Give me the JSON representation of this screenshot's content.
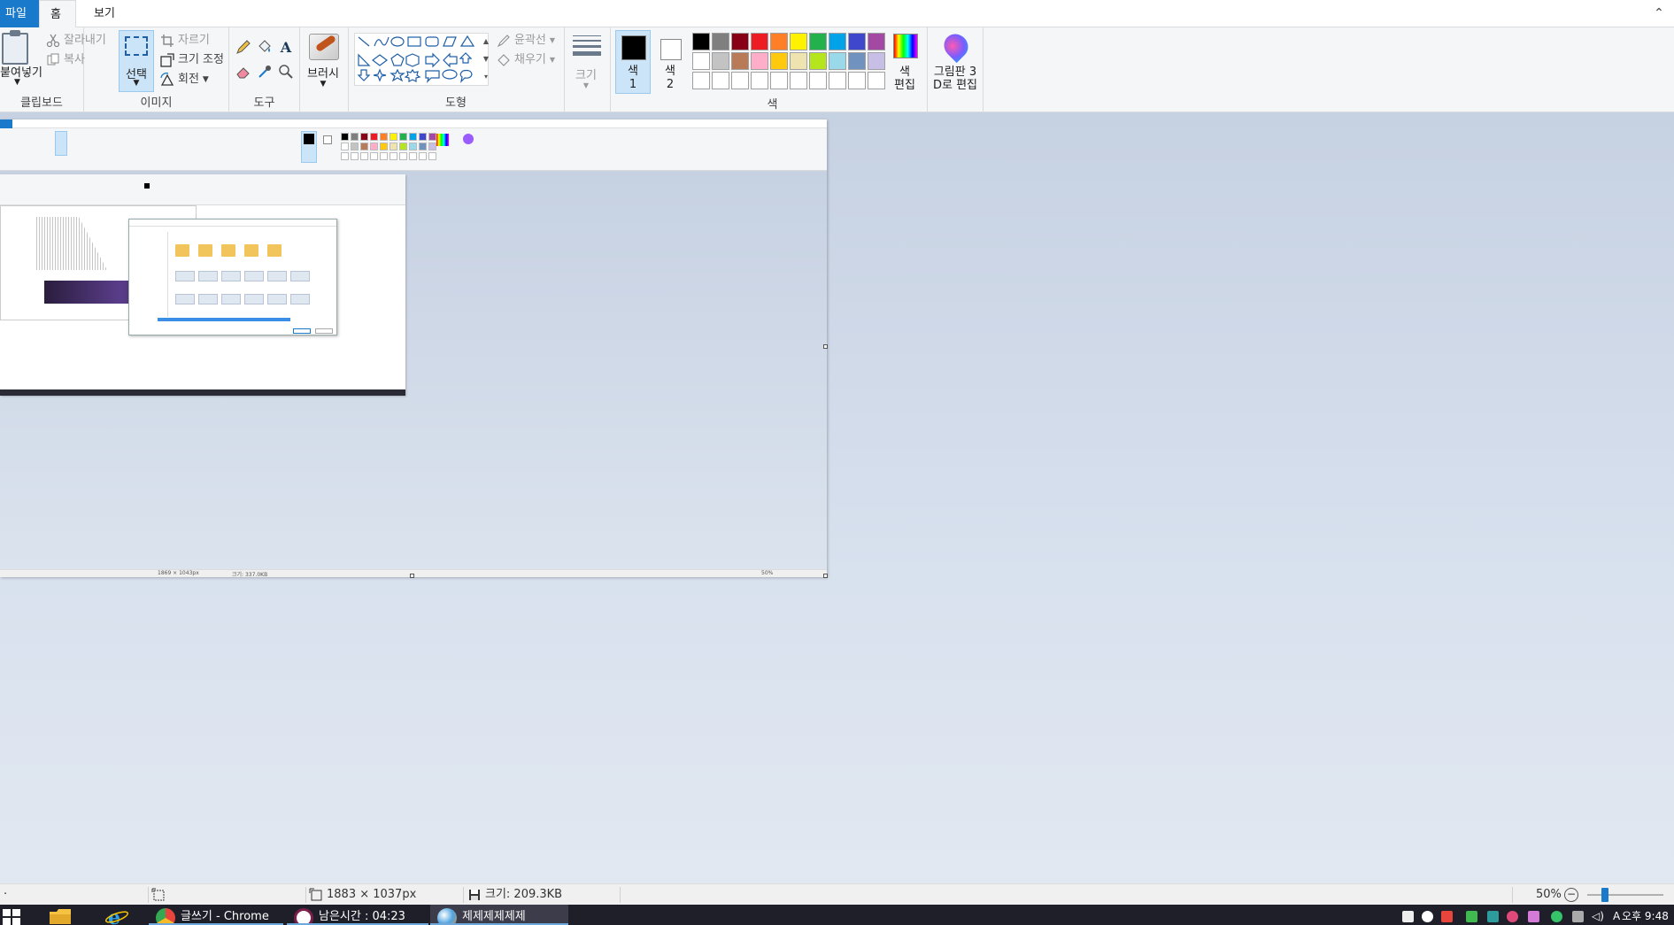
{
  "ribbon_tabs": {
    "file": "파일",
    "home": "홈",
    "view": "보기"
  },
  "clipboard": {
    "paste": "붙여넣기",
    "cut": "잘라내기",
    "copy": "복사",
    "group": "클립보드"
  },
  "image": {
    "select": "선택",
    "crop": "자르기",
    "resize": "크기 조정",
    "rotate": "회전",
    "group": "이미지"
  },
  "tools": {
    "group": "도구"
  },
  "brushes": {
    "label": "브러시"
  },
  "shapes": {
    "outline": "윤곽선",
    "fill": "채우기",
    "group": "도형"
  },
  "size": {
    "label": "크기"
  },
  "colors": {
    "color1": "색\n1",
    "color2": "색\n2",
    "edit": "색\n편집",
    "group": "색",
    "color1_value": "#000000",
    "color2_value": "#ffffff",
    "palette": [
      "#000000",
      "#7f7f7f",
      "#880015",
      "#ed1c24",
      "#ff7f27",
      "#fff200",
      "#22b14c",
      "#00a2e8",
      "#3f48cc",
      "#a349a4",
      "#ffffff",
      "#c3c3c3",
      "#b97a57",
      "#ffaec9",
      "#ffc90e",
      "#efe4b0",
      "#b5e61d",
      "#99d9ea",
      "#7092be",
      "#c8bfe7",
      "#ffffff",
      "#ffffff",
      "#ffffff",
      "#ffffff",
      "#ffffff",
      "#ffffff",
      "#ffffff",
      "#ffffff",
      "#ffffff",
      "#ffffff"
    ]
  },
  "paint3d": {
    "label": "그림판 3\nD로 편집"
  },
  "statusbar": {
    "dimensions": "1883 × 1037px",
    "size": "크기: 209.3KB",
    "zoom": "50%"
  },
  "nested": {
    "dimensions": "1869 × 1043px",
    "size": "크기: 337.0KB",
    "zoom": "50%"
  },
  "taskbar": {
    "apps": [
      {
        "label": "글쓰기 - Chrome",
        "color": "#e8453c"
      },
      {
        "label": "남은시간 : 04:23",
        "color": "#ffffff"
      },
      {
        "label": "제제제제제제",
        "color": "#4fa3e0"
      }
    ],
    "time": "오후 9:48"
  }
}
